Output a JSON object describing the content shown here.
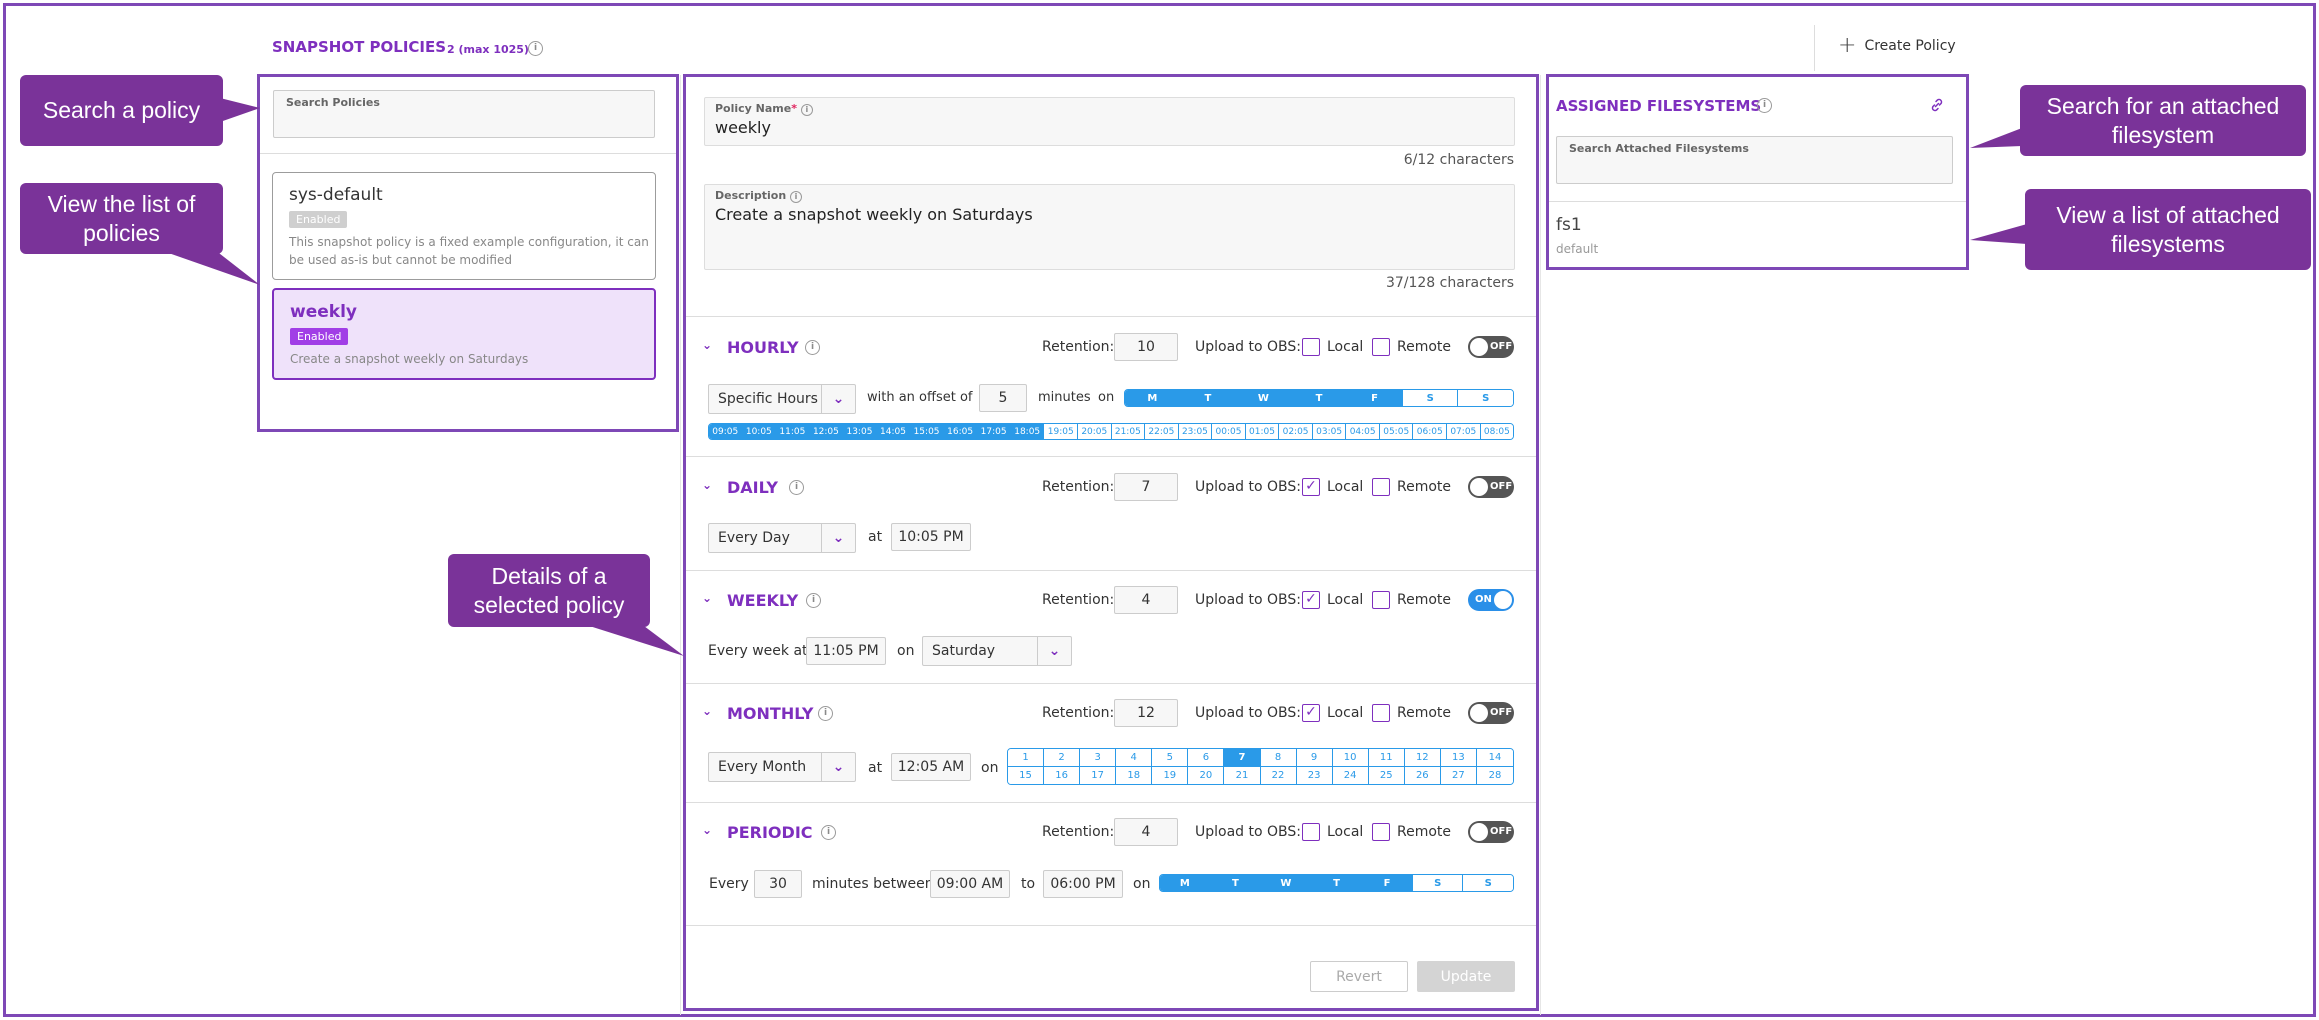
{
  "header": {
    "title": "SNAPSHOT POLICIES",
    "count": "2 (max 1025)",
    "create_label": "Create Policy"
  },
  "search": {
    "policies_label": "Search Policies",
    "filesystems_label": "Search Attached Filesystems"
  },
  "policies": [
    {
      "name": "sys-default",
      "status": "Enabled",
      "description": "This snapshot policy is a fixed example configuration, it can be used as-is but cannot be modified",
      "selected": false
    },
    {
      "name": "weekly",
      "status": "Enabled",
      "description": "Create a snapshot weekly on Saturdays",
      "selected": true
    }
  ],
  "details": {
    "policy_name_label": "Policy Name",
    "policy_name": "weekly",
    "policy_name_chars": "6/12 characters",
    "description_label": "Description",
    "description": "Create a snapshot weekly on Saturdays",
    "description_chars": "37/128 characters",
    "retention_label": "Retention:",
    "upload_label": "Upload to OBS:",
    "local_label": "Local",
    "remote_label": "Remote",
    "on_label": "ON",
    "off_label": "OFF",
    "hourly": {
      "name": "HOURLY",
      "retention": "10",
      "local": false,
      "remote": false,
      "enabled": false,
      "mode": "Specific Hours",
      "offset_label": "with an offset of",
      "offset": "5",
      "minutes_label": "minutes",
      "on_label": "on",
      "days": [
        {
          "d": "M",
          "on": true
        },
        {
          "d": "T",
          "on": true
        },
        {
          "d": "W",
          "on": true
        },
        {
          "d": "T",
          "on": true
        },
        {
          "d": "F",
          "on": true
        },
        {
          "d": "S",
          "on": false
        },
        {
          "d": "S",
          "on": false
        }
      ],
      "hours": [
        {
          "h": "09:05",
          "on": true
        },
        {
          "h": "10:05",
          "on": true
        },
        {
          "h": "11:05",
          "on": true
        },
        {
          "h": "12:05",
          "on": true
        },
        {
          "h": "13:05",
          "on": true
        },
        {
          "h": "14:05",
          "on": true
        },
        {
          "h": "15:05",
          "on": true
        },
        {
          "h": "16:05",
          "on": true
        },
        {
          "h": "17:05",
          "on": true
        },
        {
          "h": "18:05",
          "on": true
        },
        {
          "h": "19:05",
          "on": false
        },
        {
          "h": "20:05",
          "on": false
        },
        {
          "h": "21:05",
          "on": false
        },
        {
          "h": "22:05",
          "on": false
        },
        {
          "h": "23:05",
          "on": false
        },
        {
          "h": "00:05",
          "on": false
        },
        {
          "h": "01:05",
          "on": false
        },
        {
          "h": "02:05",
          "on": false
        },
        {
          "h": "03:05",
          "on": false
        },
        {
          "h": "04:05",
          "on": false
        },
        {
          "h": "05:05",
          "on": false
        },
        {
          "h": "06:05",
          "on": false
        },
        {
          "h": "07:05",
          "on": false
        },
        {
          "h": "08:05",
          "on": false
        }
      ]
    },
    "daily": {
      "name": "DAILY",
      "retention": "7",
      "local": true,
      "remote": false,
      "enabled": false,
      "mode": "Every Day",
      "at_label": "at",
      "time": "10:05 PM"
    },
    "weekly": {
      "name": "WEEKLY",
      "retention": "4",
      "local": true,
      "remote": false,
      "enabled": true,
      "every_label": "Every week at",
      "time": "11:05 PM",
      "on_label": "on",
      "day": "Saturday"
    },
    "monthly": {
      "name": "MONTHLY",
      "retention": "12",
      "local": true,
      "remote": false,
      "enabled": false,
      "mode": "Every Month",
      "at_label": "at",
      "time": "12:05 AM",
      "on_label": "on",
      "dates": [
        "1",
        "2",
        "3",
        "4",
        "5",
        "6",
        "7",
        "8",
        "9",
        "10",
        "11",
        "12",
        "13",
        "14",
        "15",
        "16",
        "17",
        "18",
        "19",
        "20",
        "21",
        "22",
        "23",
        "24",
        "25",
        "26",
        "27",
        "28"
      ],
      "selected_date": "7"
    },
    "periodic": {
      "name": "PERIODIC",
      "retention": "4",
      "local": false,
      "remote": false,
      "enabled": false,
      "every_label": "Every",
      "interval": "30",
      "between_label": "minutes between",
      "from": "09:00 AM",
      "to_label": "to",
      "to": "06:00 PM",
      "on_label": "on",
      "days": [
        {
          "d": "M",
          "on": true
        },
        {
          "d": "T",
          "on": true
        },
        {
          "d": "W",
          "on": true
        },
        {
          "d": "T",
          "on": true
        },
        {
          "d": "F",
          "on": true
        },
        {
          "d": "S",
          "on": false
        },
        {
          "d": "S",
          "on": false
        }
      ]
    },
    "revert_label": "Revert",
    "update_label": "Update"
  },
  "filesystems": {
    "title": "ASSIGNED FILESYSTEMS",
    "items": [
      {
        "name": "fs1",
        "group": "default"
      }
    ]
  },
  "callouts": {
    "search_policy": "Search a policy",
    "view_policies": "View the list of policies",
    "details": "Details of a selected policy",
    "search_fs": "Search for an attached filesystem",
    "view_fs": "View a list of attached filesystems"
  },
  "colors": {
    "accent": "#7e2fbe",
    "frame": "#7e48b6",
    "callout": "#7a3399",
    "selected_day": "#2a9ae8"
  }
}
